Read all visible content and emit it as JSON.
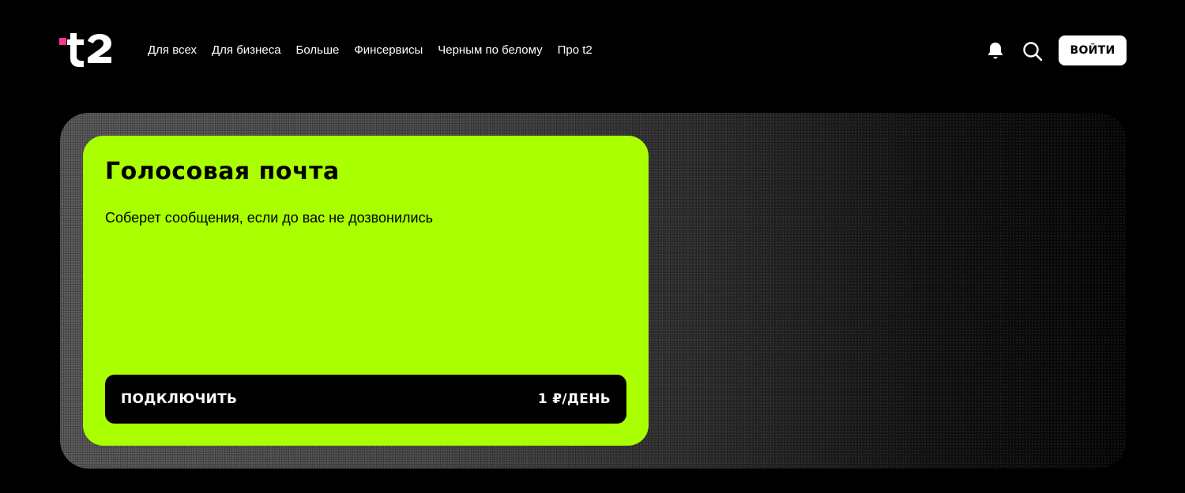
{
  "header": {
    "logo_alt": "t2",
    "nav": [
      {
        "label": "Для всех"
      },
      {
        "label": "Для бизнеса"
      },
      {
        "label": "Больше"
      },
      {
        "label": "Финсервисы"
      },
      {
        "label": "Черным по белому"
      },
      {
        "label": "Про t2"
      }
    ],
    "icons": {
      "notifications": "bell-icon",
      "search": "search-icon"
    },
    "login_label": "ВОЙТИ"
  },
  "hero": {
    "title": "Голосовая почта",
    "description": "Соберет сообщения, если до вас не дозвонились",
    "cta_label": "ПОДКЛЮЧИТЬ",
    "price": "1 ₽/ДЕНЬ"
  },
  "colors": {
    "background": "#000000",
    "card": "#aaff00",
    "logo_accent": "#ff3495",
    "button_dark": "#000000",
    "button_light": "#ffffff"
  }
}
